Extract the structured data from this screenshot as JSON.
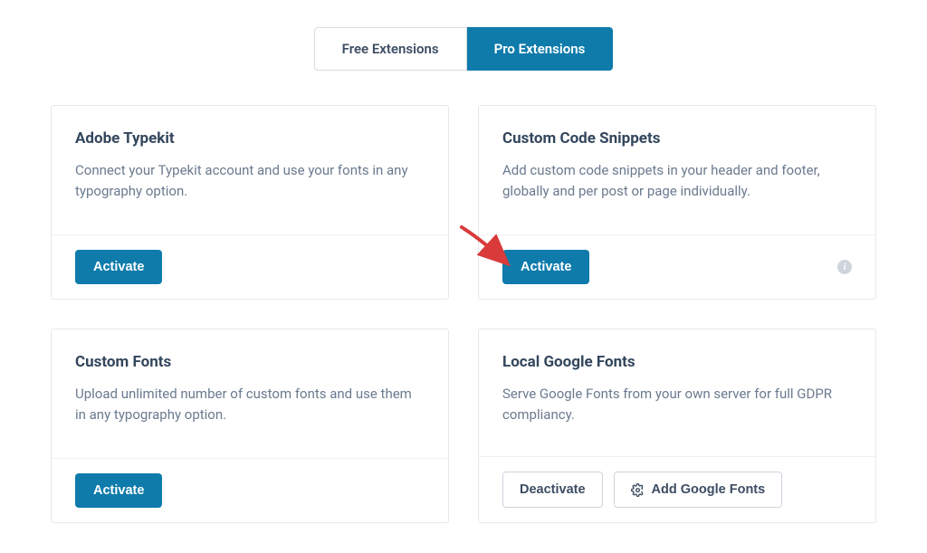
{
  "tabs": {
    "free": "Free Extensions",
    "pro": "Pro Extensions"
  },
  "buttons": {
    "activate": "Activate",
    "deactivate": "Deactivate",
    "addGoogleFonts": "Add Google Fonts"
  },
  "cards": {
    "typekit": {
      "title": "Adobe Typekit",
      "desc": "Connect your Typekit account and use your fonts in any typography option."
    },
    "snippets": {
      "title": "Custom Code Snippets",
      "desc": "Add custom code snippets in your header and footer, globally and per post or page individually."
    },
    "customFonts": {
      "title": "Custom Fonts",
      "desc": "Upload unlimited number of custom fonts and use them in any typography option."
    },
    "localGoogle": {
      "title": "Local Google Fonts",
      "desc": "Serve Google Fonts from your own server for full GDPR compliancy."
    }
  }
}
